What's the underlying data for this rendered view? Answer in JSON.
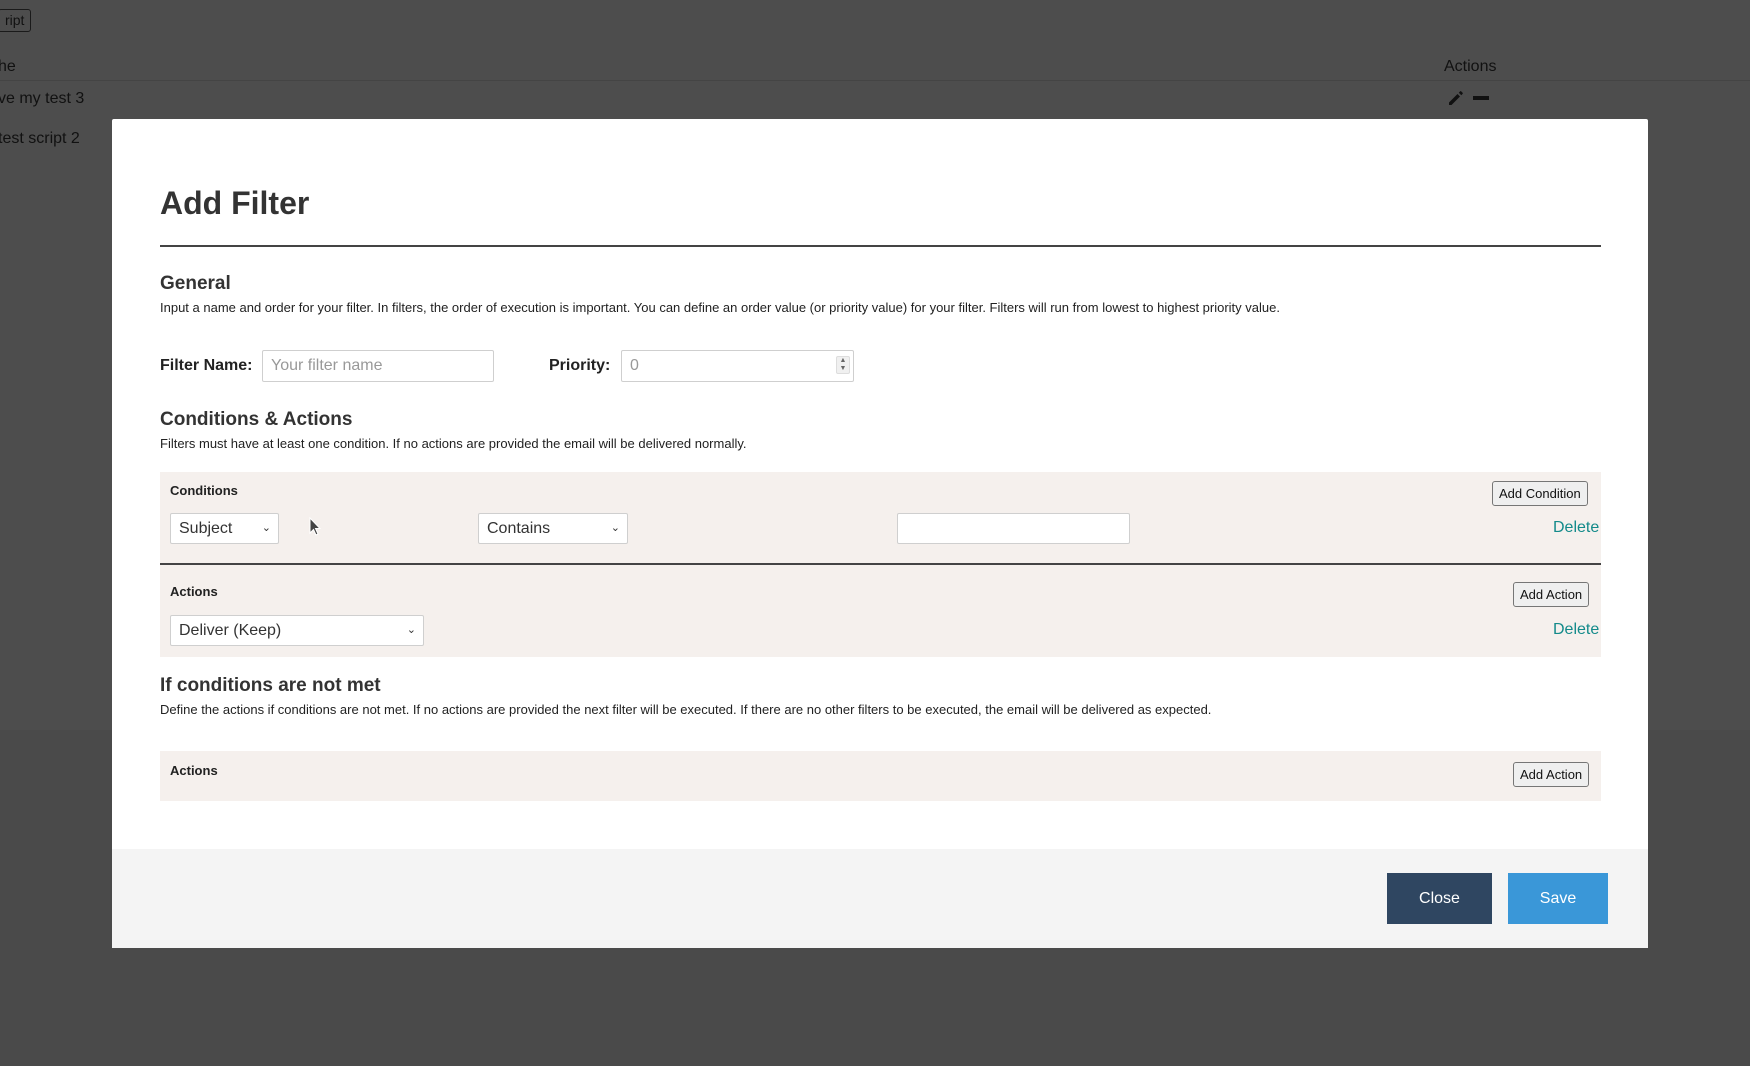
{
  "background": {
    "script_button_label": "ript",
    "table_header_name": "he",
    "table_header_actions": "Actions",
    "rows": [
      {
        "name": "ve my test 3"
      },
      {
        "name": "test script 2"
      }
    ]
  },
  "modal": {
    "title": "Add Filter",
    "general": {
      "title": "General",
      "description": "Input a name and order for your filter. In filters, the order of execution is important. You can define an order value (or priority value) for your filter. Filters will run from lowest to highest priority value.",
      "filter_name_label": "Filter Name:",
      "filter_name_placeholder": "Your filter name",
      "filter_name_value": "",
      "priority_label": "Priority:",
      "priority_placeholder": "0"
    },
    "conditions_actions": {
      "title": "Conditions & Actions",
      "description": "Filters must have at least one condition. If no actions are provided the email will be delivered normally.",
      "conditions_label": "Conditions",
      "add_condition_label": "Add Condition",
      "condition": {
        "field_selected": "Subject",
        "operator_selected": "Contains",
        "value": "",
        "delete_label": "Delete"
      },
      "actions_label": "Actions",
      "add_action_label": "Add Action",
      "action": {
        "selected": "Deliver (Keep)",
        "delete_label": "Delete"
      }
    },
    "not_met": {
      "title": "If conditions are not met",
      "description": "Define the actions if conditions are not met. If no actions are provided the next filter will be executed. If there are no other filters to be executed, the email will be delivered as expected.",
      "actions_label": "Actions",
      "add_action_label": "Add Action"
    },
    "footer": {
      "close_label": "Close",
      "save_label": "Save"
    }
  },
  "colors": {
    "overlay": "#4d4d4d",
    "panel_bg": "#f5f0ed",
    "link": "#138a8a",
    "close_button": "#2f4661",
    "save_button": "#3a97d8",
    "footer_bg": "#f4f4f4"
  },
  "icons": [
    "pencil-icon",
    "minus-icon",
    "chevron-down-icon",
    "spinner-arrows-icon",
    "mouse-cursor-icon"
  ]
}
